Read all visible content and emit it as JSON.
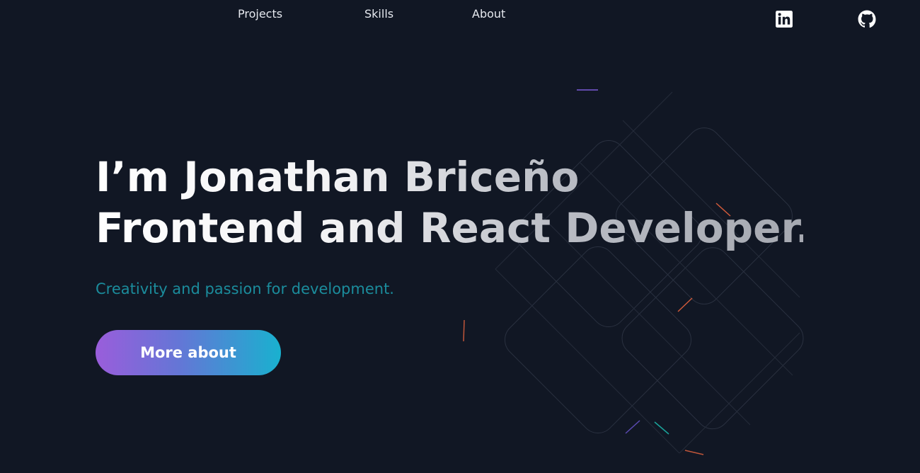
{
  "nav": {
    "links": [
      {
        "label": "Projects"
      },
      {
        "label": "Skills"
      },
      {
        "label": "About"
      }
    ]
  },
  "social": {
    "linkedin_icon": "linkedin-icon",
    "github_icon": "github-icon"
  },
  "hero": {
    "line1": "I’m Jonathan Briceño",
    "line2": "Frontend and React Developer.",
    "subtitle": "Creativity and passion for development.",
    "cta_label": "More about"
  },
  "colors": {
    "background": "#111724",
    "subtitle": "#1b8c9c",
    "cta_gradient_start": "#9a5ddb",
    "cta_gradient_end": "#19b1cf"
  }
}
